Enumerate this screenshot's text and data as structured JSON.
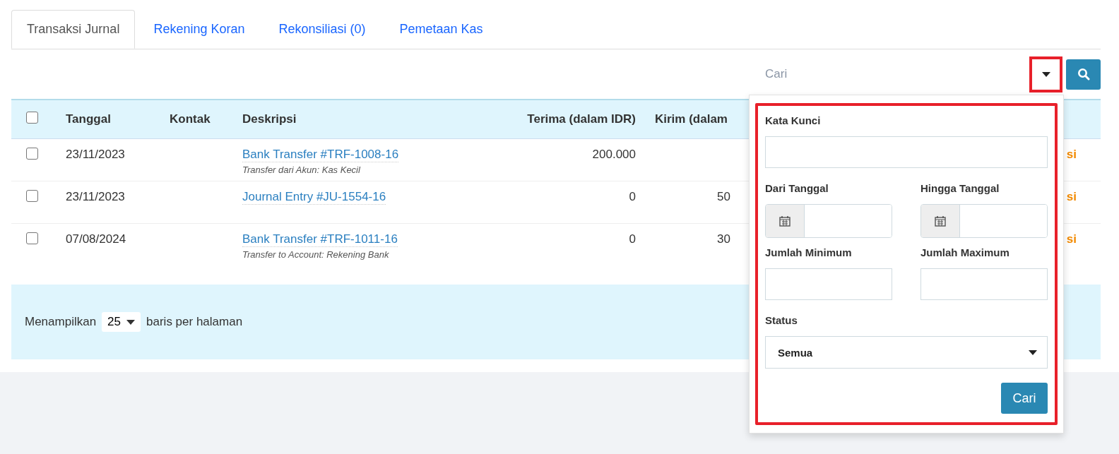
{
  "tabs": [
    {
      "label": "Transaksi Jurnal",
      "selected": true
    },
    {
      "label": "Rekening Koran",
      "selected": false
    },
    {
      "label": "Rekonsiliasi (0)",
      "selected": false
    },
    {
      "label": "Pemetaan Kas",
      "selected": false
    }
  ],
  "search": {
    "placeholder": "Cari"
  },
  "table": {
    "select_all_checked": false,
    "columns": [
      "Tanggal",
      "Kontak",
      "Deskripsi",
      "Terima (dalam IDR)",
      "Kirim (dalam"
    ],
    "rows": [
      {
        "checked": false,
        "date": "23/11/2023",
        "link": "Bank Transfer #TRF-1008-16",
        "note": "Transfer dari Akun: Kas Kecil",
        "received": "200.000",
        "sent": "",
        "column_7": "si"
      },
      {
        "checked": false,
        "date": "23/11/2023",
        "link": "Journal Entry #JU-1554-16",
        "note": "",
        "received": "0",
        "sent": "50",
        "column_7": "si"
      },
      {
        "checked": false,
        "date": "07/08/2024",
        "link": "Bank Transfer #TRF-1011-16",
        "note": "Transfer to Account: Rekening Bank",
        "received": "0",
        "sent": "30",
        "column_7": "si"
      }
    ]
  },
  "pager": {
    "prefix": "Menampilkan",
    "value": "25",
    "suffix": "baris per halaman"
  },
  "filter_panel": {
    "keyword_label": "Kata Kunci",
    "from_label": "Dari Tanggal",
    "to_label": "Hingga Tanggal",
    "min_label": "Jumlah Minimum",
    "max_label": "Jumlah Maximum",
    "status_label": "Status",
    "status_value": "Semua",
    "submit": "Cari"
  }
}
